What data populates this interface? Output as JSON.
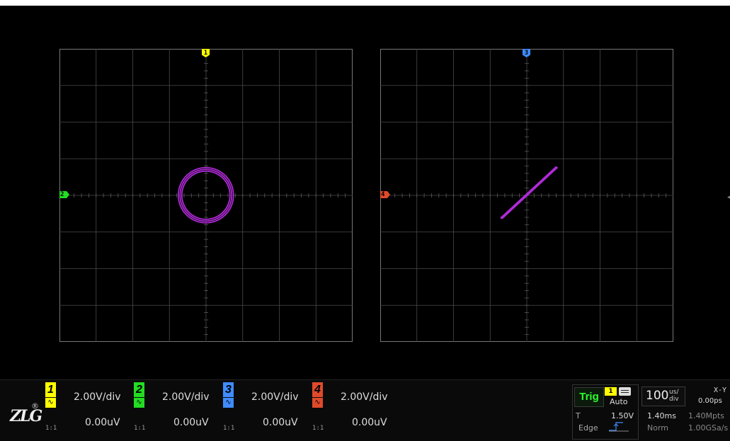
{
  "colors": {
    "ch1": "#ffff00",
    "ch2": "#22dd22",
    "ch3": "#3f8cff",
    "ch4": "#e04a2a",
    "trace": "#b02bd8",
    "grid": "#4a4a4a",
    "axis": "#5a5a5a"
  },
  "left_plot": {
    "top_marker": "1",
    "left_marker": "2",
    "shape": "circle"
  },
  "right_plot": {
    "top_marker": "3",
    "left_marker": "4",
    "shape": "line"
  },
  "logo": {
    "text": "ZLG",
    "registered": "®"
  },
  "channels": [
    {
      "number": "1",
      "scale": "2.00V/div",
      "offset": "0.00uV",
      "ratio": "1:1",
      "coupling_icon": "ac-wave-icon"
    },
    {
      "number": "2",
      "scale": "2.00V/div",
      "offset": "0.00uV",
      "ratio": "1:1",
      "coupling_icon": "ac-wave-icon"
    },
    {
      "number": "3",
      "scale": "2.00V/div",
      "offset": "0.00uV",
      "ratio": "1:1",
      "coupling_icon": "ac-wave-icon"
    },
    {
      "number": "4",
      "scale": "2.00V/div",
      "offset": "0.00uV",
      "ratio": "1:1",
      "coupling_icon": "ac-wave-icon"
    }
  ],
  "trigger": {
    "label": "Trig",
    "source": "1",
    "mode": "Auto",
    "t_label": "T",
    "level": "1.50V",
    "type": "Edge",
    "slope_icon": "rising-edge-icon"
  },
  "timebase": {
    "value": "100",
    "unit_top": "us/",
    "unit_bottom": "div",
    "display_mode": "X-Y",
    "delay": "0.00ps",
    "record_time": "1.40ms",
    "memory_depth": "1.40Mpts",
    "acquisition": "Norm",
    "sample_rate": "1.00GSa/s"
  }
}
